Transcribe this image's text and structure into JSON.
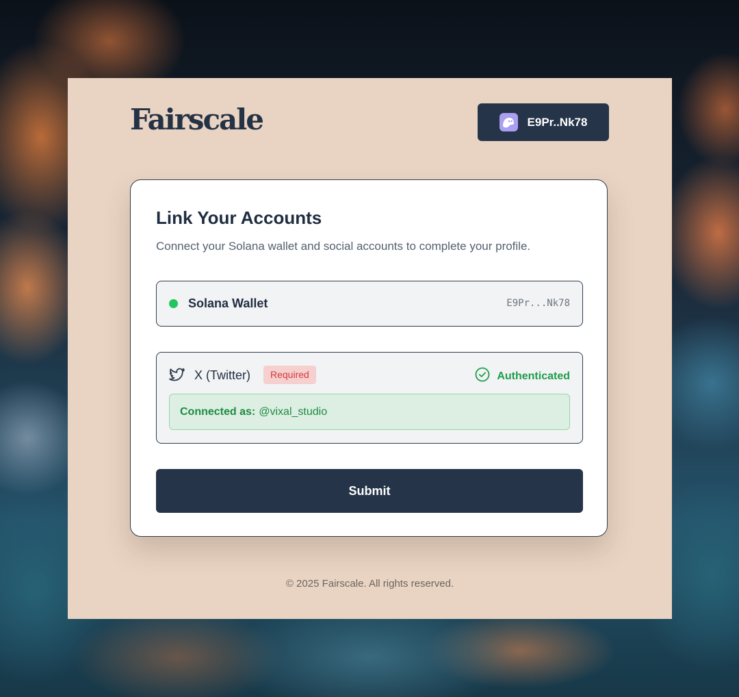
{
  "brand": {
    "logo": "Fairscale"
  },
  "header": {
    "wallet_button_label": "E9Pr..Nk78",
    "wallet_icon": "phantom-ghost-icon"
  },
  "card": {
    "title": "Link Your Accounts",
    "subtitle": "Connect your Solana wallet and social accounts to complete your profile.",
    "wallet": {
      "label": "Solana Wallet",
      "address": "E9Pr...Nk78",
      "status_color": "#22c55e"
    },
    "twitter": {
      "label": "X (Twitter)",
      "badge": "Required",
      "status": "Authenticated",
      "connected_label": "Connected as:",
      "handle": "@vixal_studio",
      "icon": "twitter-bird-icon"
    },
    "submit_label": "Submit"
  },
  "footer": {
    "text": "© 2025 Fairscale. All rights reserved."
  },
  "colors": {
    "panel": "#e9d4c3",
    "primary": "#253448",
    "success": "#1f9d4a",
    "danger": "#d43a3a"
  }
}
